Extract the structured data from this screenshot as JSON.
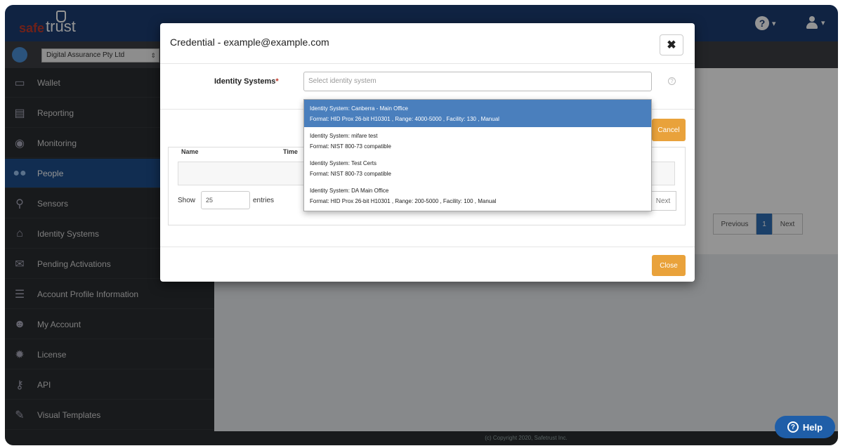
{
  "brand": {
    "safe": "safe",
    "trust": "trust"
  },
  "topbar": {
    "help_icon": "?",
    "caret": "▾"
  },
  "org": {
    "name": "Digital Assurance Pty Ltd"
  },
  "sidebar": {
    "items": [
      {
        "label": "Wallet",
        "icon": "wallet-icon"
      },
      {
        "label": "Reporting",
        "icon": "reporting-icon"
      },
      {
        "label": "Monitoring",
        "icon": "eye-icon"
      },
      {
        "label": "People",
        "icon": "people-icon",
        "active": true
      },
      {
        "label": "Sensors",
        "icon": "map-pin-icon"
      },
      {
        "label": "Identity Systems",
        "icon": "home-icon"
      },
      {
        "label": "Pending Activations",
        "icon": "envelope-icon"
      },
      {
        "label": "Account Profile Information",
        "icon": "list-icon"
      },
      {
        "label": "My Account",
        "icon": "user-icon"
      },
      {
        "label": "License",
        "icon": "gear-icon"
      },
      {
        "label": "API",
        "icon": "key-icon"
      },
      {
        "label": "Visual Templates",
        "icon": "brush-icon"
      }
    ]
  },
  "background_page": {
    "pagination": {
      "previous": "Previous",
      "page": "1",
      "next": "Next"
    }
  },
  "modal": {
    "title": "Credential - example@example.com",
    "close_symbol": "✖",
    "identity_systems_label": "Identity Systems",
    "required_mark": "*",
    "identity_systems_placeholder": "Select identity system",
    "hint_symbol": "?",
    "cancel_label": "Cancel",
    "table": {
      "col_name": "Name",
      "col_time": "Time"
    },
    "show_label": "Show",
    "page_size": "25",
    "entries_label": "entries",
    "next_label": "Next",
    "close_label": "Close"
  },
  "dropdown": {
    "options": [
      {
        "line1": "Identity System: Canberra - Main Office",
        "line2": "Format: HID Prox 26-bit H10301 , Range: 4000-5000 , Facility: 130 , Manual",
        "highlighted": true
      },
      {
        "line1": "Identity System: mifare test",
        "line2": "Format: NIST 800-73 compatible"
      },
      {
        "line1": "Identity System: Test Certs",
        "line2": "Format: NIST 800-73 compatible"
      },
      {
        "line1": "Identity System: DA Main Office",
        "line2": "Format: HID Prox 26-bit H10301 , Range: 200-5000 , Facility: 100 , Manual"
      }
    ]
  },
  "footer": {
    "copyright": "(c) Copyright 2020, Safetrust Inc."
  },
  "help_button": {
    "label": "Help",
    "symbol": "?"
  },
  "colors": {
    "topbar": "#1d3d73",
    "sidebar": "#2a2d31",
    "active_nav": "#1e4f8c",
    "accent_button": "#e9a23b",
    "dropdown_highlight": "#4a7fbd",
    "required": "#c0392b"
  }
}
